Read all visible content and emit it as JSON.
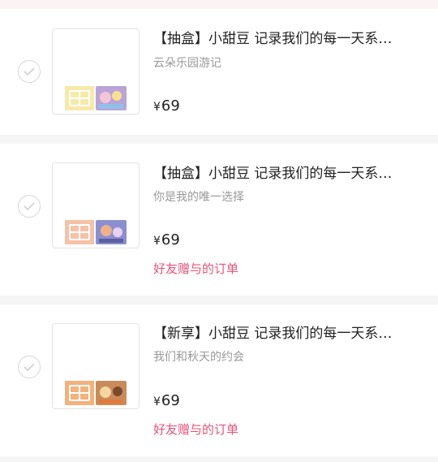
{
  "orders": [
    {
      "title": "【抽盒】小甜豆 记录我们的每一天系…",
      "subtitle": "云朵乐园游记",
      "currency": "¥",
      "price": "69",
      "gift_label": "",
      "box_color": "#f7e9a8",
      "art_color": "#b9a4d8"
    },
    {
      "title": "【抽盒】小甜豆 记录我们的每一天系…",
      "subtitle": "你是我的唯一选择",
      "currency": "¥",
      "price": "69",
      "gift_label": "好友赠与的订单",
      "box_color": "#f5c2a8",
      "art_color": "#8b8fcf"
    },
    {
      "title": "【新享】小甜豆 记录我们的每一天系…",
      "subtitle": "我们和秋天的约会",
      "currency": "¥",
      "price": "69",
      "gift_label": "好友赠与的订单",
      "box_color": "#f3b27c",
      "art_color": "#c98b5a"
    }
  ]
}
